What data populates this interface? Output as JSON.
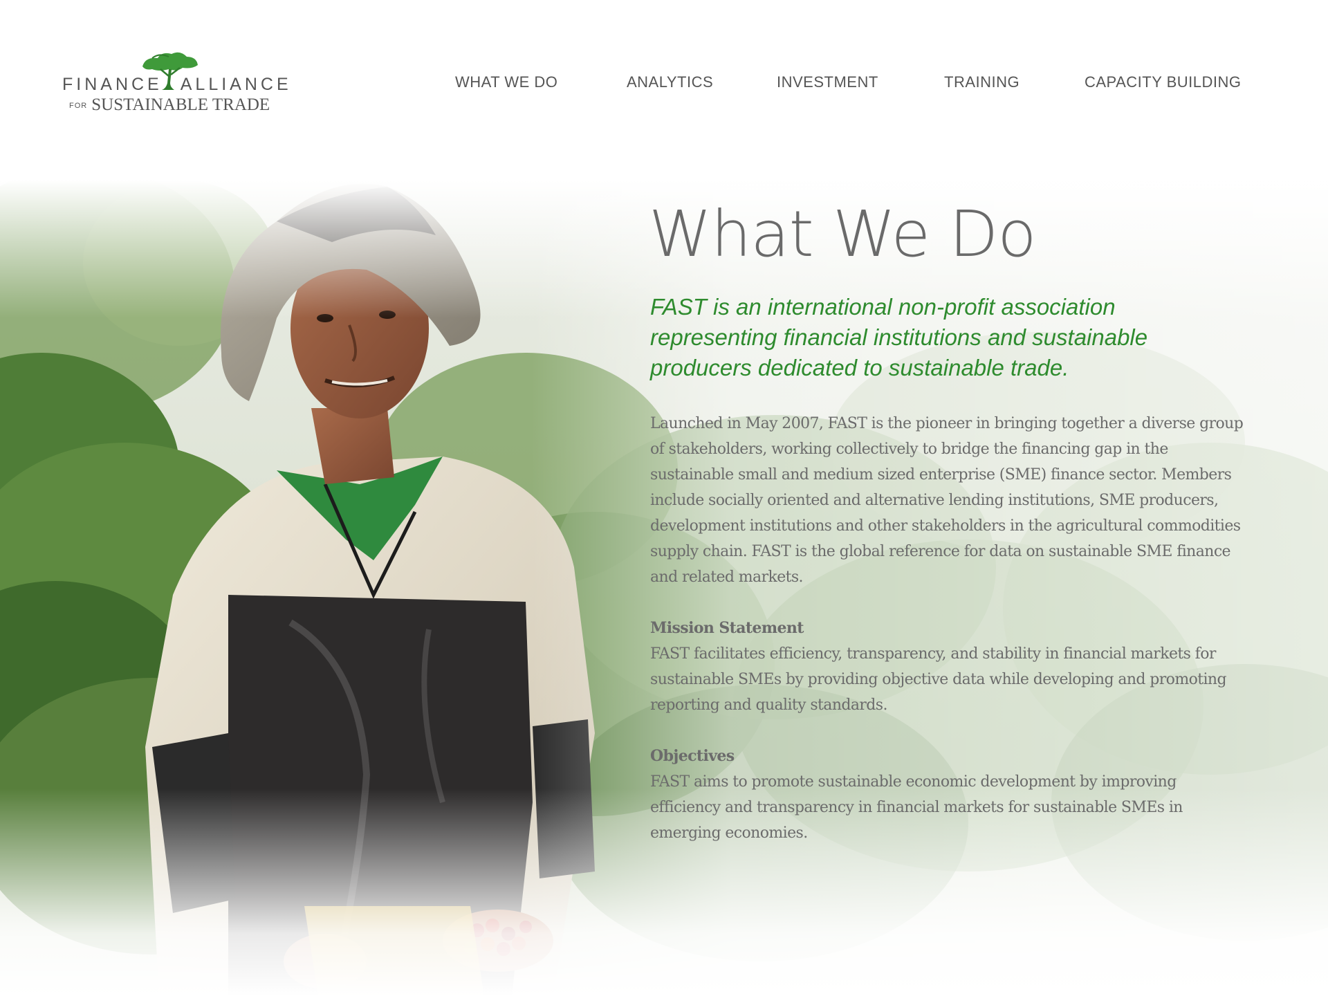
{
  "brand": {
    "logo_line1_left": "FINANCE",
    "logo_line1_right": "ALLIANCE",
    "logo_line2_prefix": "FOR",
    "logo_line2_main": "SUSTAINABLE TRADE",
    "accent_color": "#2e8b2e"
  },
  "nav": {
    "items": [
      {
        "label": "WHAT WE DO"
      },
      {
        "label": "ANALYTICS"
      },
      {
        "label": "INVESTMENT"
      },
      {
        "label": "TRAINING"
      },
      {
        "label": "CAPACITY BUILDING"
      }
    ]
  },
  "main": {
    "title": "What We Do",
    "tagline": "FAST is an international non-profit association representing financial institutions and sustainable producers dedicated to sustainable trade.",
    "intro": "Launched in May 2007, FAST is the pioneer in bringing together a diverse group of stakeholders, working collectively to bridge the financing gap in the sustainable small and medium sized enterprise (SME) finance sector. Members include socially oriented and alternative lending institutions, SME producers, development institutions and other stakeholders in the agricultural commodities supply chain. FAST is the global reference for data on sustainable SME finance and related markets.",
    "sections": [
      {
        "heading": "Mission Statement",
        "body": "FAST facilitates efficiency, transparency, and stability in financial markets for sustainable SMEs by providing objective data while developing and promoting reporting and quality standards."
      },
      {
        "heading": "Objectives",
        "body": "FAST aims to promote sustainable economic development by improving efficiency and transparency in financial markets for sustainable SMEs in emerging economies."
      }
    ]
  },
  "hero": {
    "image_icon": "coffee-farmer-photo"
  }
}
